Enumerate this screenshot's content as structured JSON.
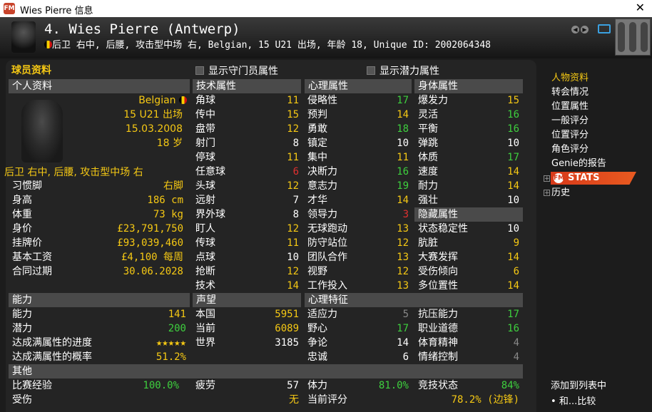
{
  "window": {
    "title": "Wies Pierre 信息",
    "app_icon": "FM",
    "close": "✕"
  },
  "header": {
    "name": "4. Wies Pierre (Antwerp)",
    "description": "后卫 右中, 后腰, 攻击型中场 右, Belgian, 15 U21 出场, 年龄 18, Unique ID: 2002064348"
  },
  "panel": {
    "title": "球员资料",
    "show_gk": "显示守门员属性",
    "show_potential": "显示潜力属性"
  },
  "personal": {
    "header": "个人资料",
    "nationality": "Belgian",
    "caps": "15 U21 出场",
    "dob": "15.03.2008",
    "age": "18 岁",
    "positions": "后卫 右中, 后腰, 攻击型中场 右",
    "rows": [
      {
        "label": "习惯脚",
        "value": "右脚"
      },
      {
        "label": "身高",
        "value": "186 cm"
      },
      {
        "label": "体重",
        "value": "73 kg"
      },
      {
        "label": "身价",
        "value": "£23,791,750"
      },
      {
        "label": "挂牌价",
        "value": "£93,039,460"
      },
      {
        "label": "基本工资",
        "value": "£4,100 每周"
      },
      {
        "label": "合同过期",
        "value": "30.06.2028"
      }
    ]
  },
  "ability": {
    "header": "能力",
    "rows": [
      {
        "label": "能力",
        "value": "141",
        "color": "#f5c814"
      },
      {
        "label": "潜力",
        "value": "200",
        "color": "#3ecf3e"
      },
      {
        "label": "达成满属性的进度",
        "value": "★★★★★",
        "color": "#f5c814"
      },
      {
        "label": "达成满属性的概率",
        "value": "51.2%",
        "color": "#f5c814"
      }
    ]
  },
  "technical": {
    "header": "技术属性",
    "rows": [
      {
        "label": "角球",
        "value": "11",
        "color": "#f5c814"
      },
      {
        "label": "传中",
        "value": "15",
        "color": "#f5c814"
      },
      {
        "label": "盘带",
        "value": "12",
        "color": "#f5c814"
      },
      {
        "label": "射门",
        "value": "8",
        "color": "#ffffff"
      },
      {
        "label": "停球",
        "value": "11",
        "color": "#f5c814"
      },
      {
        "label": "任意球",
        "value": "6",
        "color": "#e03030"
      },
      {
        "label": "头球",
        "value": "12",
        "color": "#f5c814"
      },
      {
        "label": "远射",
        "value": "7",
        "color": "#ffffff"
      },
      {
        "label": "界外球",
        "value": "8",
        "color": "#ffffff"
      },
      {
        "label": "盯人",
        "value": "12",
        "color": "#f5c814"
      },
      {
        "label": "传球",
        "value": "11",
        "color": "#f5c814"
      },
      {
        "label": "点球",
        "value": "10",
        "color": "#ffffff"
      },
      {
        "label": "抢断",
        "value": "12",
        "color": "#f5c814"
      },
      {
        "label": "技术",
        "value": "14",
        "color": "#f5c814"
      }
    ]
  },
  "mental": {
    "header": "心理属性",
    "rows": [
      {
        "label": "侵略性",
        "value": "17",
        "color": "#3ecf3e"
      },
      {
        "label": "预判",
        "value": "14",
        "color": "#f5c814"
      },
      {
        "label": "勇敢",
        "value": "18",
        "color": "#3ecf3e"
      },
      {
        "label": "镇定",
        "value": "10",
        "color": "#ffffff"
      },
      {
        "label": "集中",
        "value": "11",
        "color": "#f5c814"
      },
      {
        "label": "决断力",
        "value": "16",
        "color": "#3ecf3e"
      },
      {
        "label": "意志力",
        "value": "19",
        "color": "#3ecf3e"
      },
      {
        "label": "才华",
        "value": "14",
        "color": "#f5c814"
      },
      {
        "label": "领导力",
        "value": "3",
        "color": "#e03030"
      },
      {
        "label": "无球跑动",
        "value": "13",
        "color": "#f5c814"
      },
      {
        "label": "防守站位",
        "value": "12",
        "color": "#f5c814"
      },
      {
        "label": "团队合作",
        "value": "13",
        "color": "#f5c814"
      },
      {
        "label": "视野",
        "value": "12",
        "color": "#f5c814"
      },
      {
        "label": "工作投入",
        "value": "13",
        "color": "#f5c814"
      }
    ]
  },
  "physical": {
    "header": "身体属性",
    "rows": [
      {
        "label": "爆发力",
        "value": "15",
        "color": "#f5c814"
      },
      {
        "label": "灵活",
        "value": "16",
        "color": "#3ecf3e"
      },
      {
        "label": "平衡",
        "value": "16",
        "color": "#3ecf3e"
      },
      {
        "label": "弹跳",
        "value": "10",
        "color": "#ffffff"
      },
      {
        "label": "体质",
        "value": "17",
        "color": "#3ecf3e"
      },
      {
        "label": "速度",
        "value": "14",
        "color": "#f5c814"
      },
      {
        "label": "耐力",
        "value": "14",
        "color": "#f5c814"
      },
      {
        "label": "强壮",
        "value": "10",
        "color": "#ffffff"
      }
    ]
  },
  "hidden": {
    "header": "隐藏属性",
    "rows": [
      {
        "label": "状态稳定性",
        "value": "10",
        "color": "#ffffff"
      },
      {
        "label": "肮脏",
        "value": "9",
        "color": "#f5c814"
      },
      {
        "label": "大赛发挥",
        "value": "14",
        "color": "#f5c814"
      },
      {
        "label": "受伤倾向",
        "value": "6",
        "color": "#f5c814"
      },
      {
        "label": "多位置性",
        "value": "14",
        "color": "#f5c814"
      }
    ]
  },
  "reputation": {
    "header": "声望",
    "rows": [
      {
        "label": "本国",
        "value": "5951",
        "color": "#f5c814"
      },
      {
        "label": "当前",
        "value": "6089",
        "color": "#f5c814"
      },
      {
        "label": "世界",
        "value": "3185",
        "color": "#ffffff"
      }
    ]
  },
  "traits": {
    "header": "心理特征",
    "rows": [
      {
        "label": "适应力",
        "value": "5",
        "color": "#888888"
      },
      {
        "label": "野心",
        "value": "17",
        "color": "#3ecf3e"
      },
      {
        "label": "争论",
        "value": "14",
        "color": "#ffffff"
      },
      {
        "label": "忠诚",
        "value": "6",
        "color": "#ffffff"
      }
    ],
    "rows2": [
      {
        "label": "抗压能力",
        "value": "17",
        "color": "#3ecf3e"
      },
      {
        "label": "职业道德",
        "value": "16",
        "color": "#3ecf3e"
      },
      {
        "label": "体育精神",
        "value": "4",
        "color": "#888888"
      },
      {
        "label": "情绪控制",
        "value": "4",
        "color": "#888888"
      }
    ]
  },
  "other": {
    "header": "其他",
    "experience": {
      "label": "比赛经验",
      "value": "100.0%"
    },
    "injury": {
      "label": "受伤",
      "value": "无"
    },
    "fatigue": {
      "label": "疲劳",
      "value": "57"
    },
    "stamina": {
      "label": "体力",
      "value": "81.0%"
    },
    "form": {
      "label": "竞技状态",
      "value": "84%"
    },
    "rating": {
      "label": "当前评分",
      "value": "78.2% (边锋)"
    }
  },
  "sidebar": {
    "items": [
      "人物资料",
      "转会情况",
      "位置属性",
      "一般评分",
      "位置评分",
      "角色评分",
      "Genie的报告"
    ],
    "stats": "STATS",
    "history": "历史",
    "add_to_list": "添加到列表中",
    "compare": "和...比较"
  }
}
